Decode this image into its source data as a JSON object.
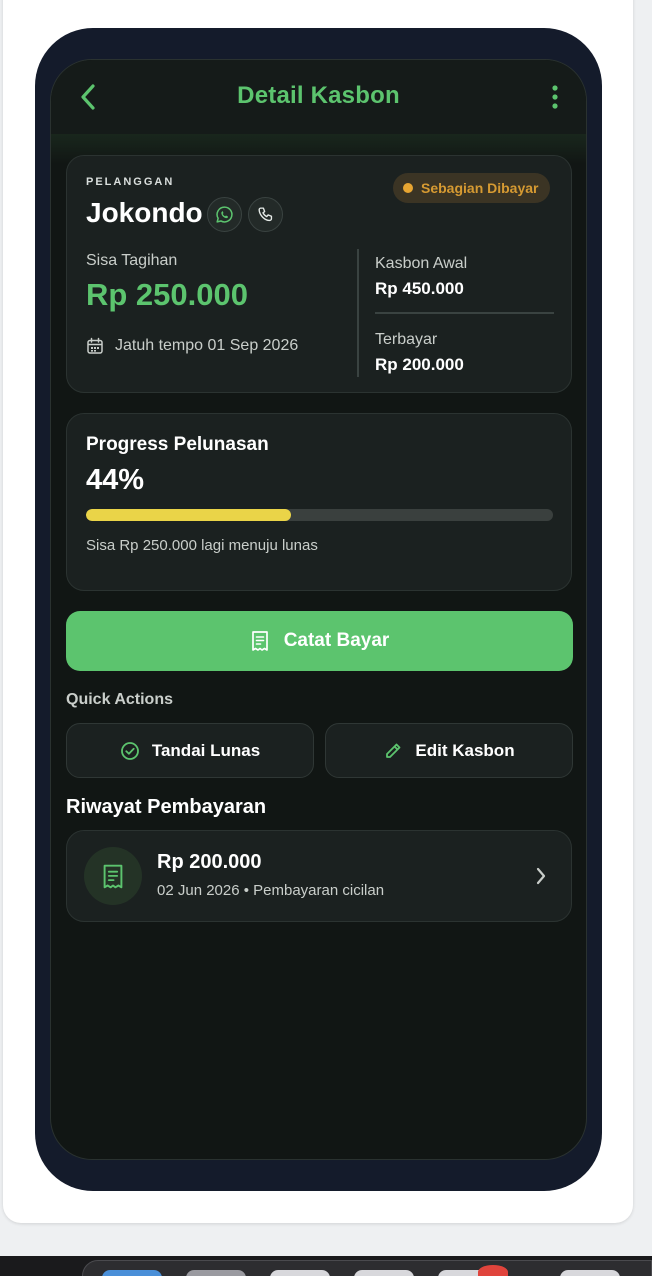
{
  "header": {
    "title": "Detail Kasbon",
    "back_icon": "chevron-left-icon",
    "more_icon": "more-vertical-icon",
    "accent_color": "#5cc46e"
  },
  "customer": {
    "section_label": "PELANGGAN",
    "name": "Jokondo",
    "whatsapp_icon": "whatsapp-icon",
    "phone_icon": "phone-icon",
    "status": "Sebagian Dibayar",
    "status_color": "#e7a532",
    "remaining_label": "Sisa Tagihan",
    "remaining_value": "Rp 250.000",
    "due_text": "Jatuh tempo 01 Sep 2026",
    "initial_label": "Kasbon Awal",
    "initial_value": "Rp 450.000",
    "paid_label": "Terbayar",
    "paid_value": "Rp 200.000"
  },
  "progress": {
    "title": "Progress Pelunasan",
    "percent_label": "44%",
    "percent": 44,
    "bar_color": "#ead448",
    "note": "Sisa Rp 250.000 lagi menuju lunas"
  },
  "actions": {
    "record_payment": "Catat Bayar",
    "quick_title": "Quick Actions",
    "mark_paid": "Tandai Lunas",
    "edit": "Edit Kasbon"
  },
  "history": {
    "title": "Riwayat Pembayaran",
    "items": [
      {
        "amount": "Rp 200.000",
        "meta": "02 Jun 2026 • Pembayaran cicilan"
      }
    ]
  }
}
